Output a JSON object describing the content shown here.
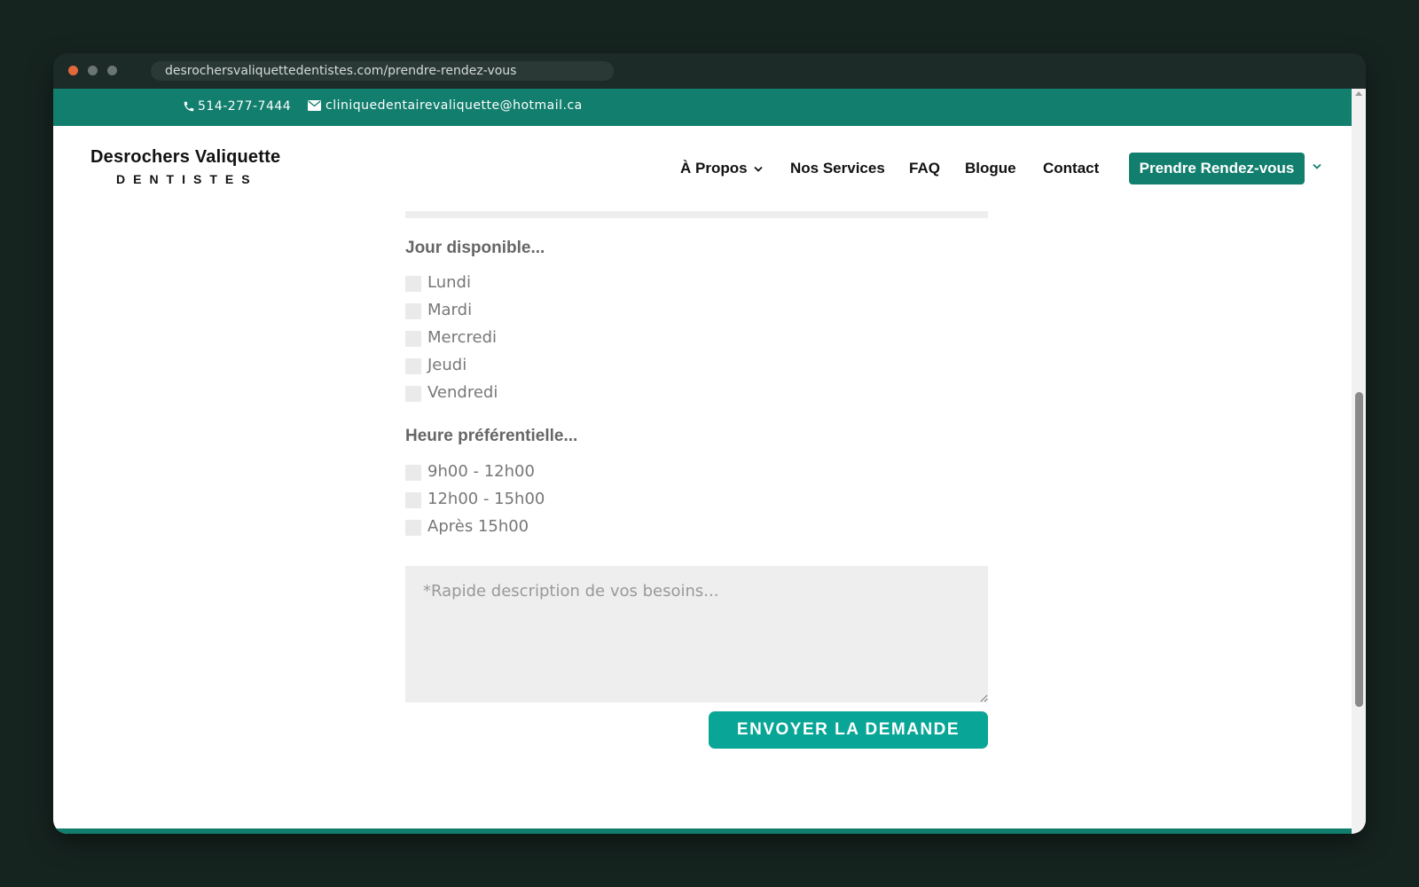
{
  "browser": {
    "url": "desrochersvaliquettedentistes.com/prendre-rendez-vous"
  },
  "topbar": {
    "phone": "514-277-7444",
    "email": "cliniquedentairevaliquette@hotmail.ca",
    "phone_icon": "phone-icon",
    "email_icon": "envelope-icon"
  },
  "logo": {
    "line1": "Desrochers Valiquette",
    "line2": "DENTISTES"
  },
  "nav": {
    "apropos": "À Propos",
    "services": "Nos Services",
    "faq": "FAQ",
    "blogue": "Blogue",
    "contact": "Contact",
    "cta": "Prendre Rendez-vous"
  },
  "form": {
    "days_label": "Jour disponible...",
    "days": [
      "Lundi",
      "Mardi",
      "Mercredi",
      "Jeudi",
      "Vendredi"
    ],
    "times_label": "Heure préférentielle...",
    "times": [
      "9h00 - 12h00",
      "12h00 - 15h00",
      "Après 15h00"
    ],
    "description_placeholder": "*Rapide description de vos besoins...",
    "submit_label": "ENVOYER LA DEMANDE"
  },
  "colors": {
    "brand": "#127e6d",
    "button": "#09a697",
    "field_bg": "#eeeeee",
    "outer_bg": "#162420"
  }
}
